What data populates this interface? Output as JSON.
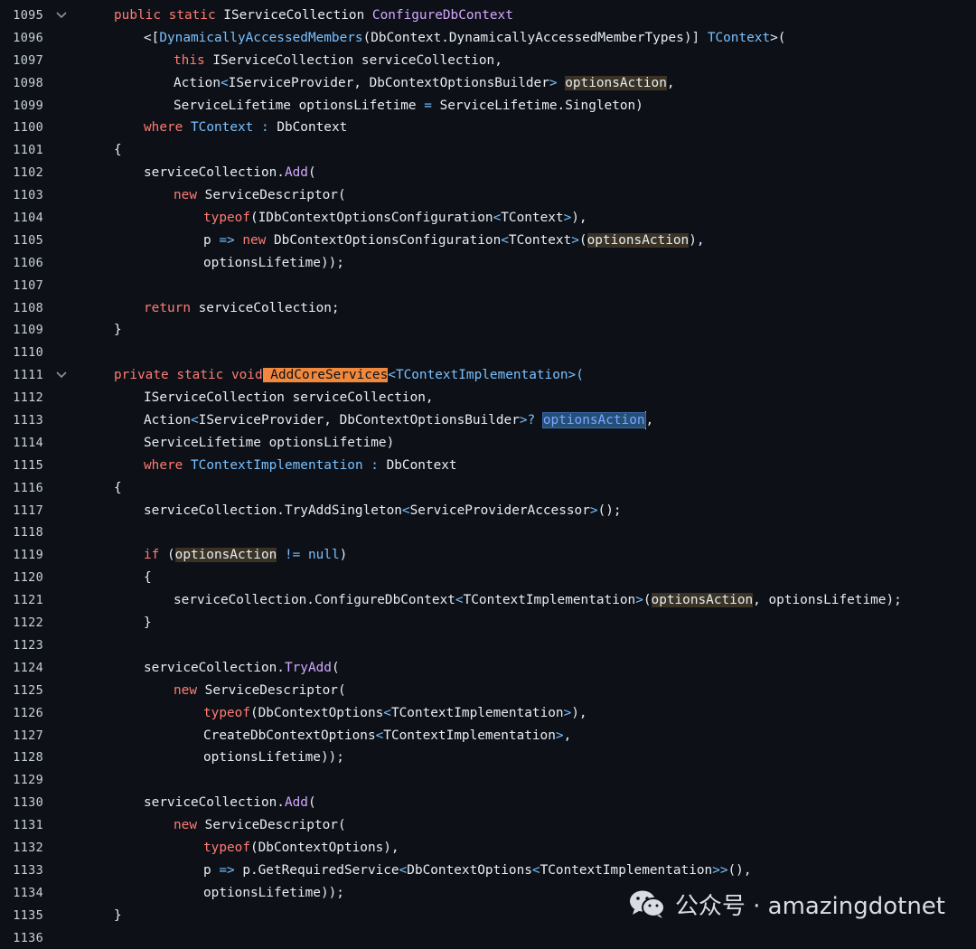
{
  "editor": {
    "lines": [
      {
        "num": "1095",
        "fold": "chevron-down-icon",
        "indent": 0,
        "tokens": [
          {
            "t": "public",
            "c": "kw"
          },
          {
            "t": " "
          },
          {
            "t": "static",
            "c": "kw"
          },
          {
            "t": " IServiceCollection ",
            "c": "id"
          },
          {
            "t": "ConfigureDbContext",
            "c": "fn"
          }
        ]
      },
      {
        "num": "1096",
        "indent": 1,
        "tokens": [
          {
            "t": "<[",
            "c": "p"
          },
          {
            "t": "DynamicallyAccessedMembers",
            "c": "ty"
          },
          {
            "t": "(DbContext.DynamicallyAccessedMemberTypes)] ",
            "c": "p"
          },
          {
            "t": "TContext",
            "c": "ty"
          },
          {
            "t": ">(",
            "c": "p"
          }
        ]
      },
      {
        "num": "1097",
        "indent": 2,
        "tokens": [
          {
            "t": "this",
            "c": "kw"
          },
          {
            "t": " IServiceCollection serviceCollection,",
            "c": "id"
          }
        ]
      },
      {
        "num": "1098",
        "indent": 2,
        "tokens": [
          {
            "t": "Action",
            "c": "id"
          },
          {
            "t": "<",
            "c": "op"
          },
          {
            "t": "IServiceProvider, DbContextOptionsBuilder",
            "c": "id"
          },
          {
            "t": ">",
            "c": "op"
          },
          {
            "t": " "
          },
          {
            "t": "optionsAction",
            "c": "id",
            "hl": "hl"
          },
          {
            "t": ",",
            "c": "p"
          }
        ]
      },
      {
        "num": "1099",
        "indent": 2,
        "tokens": [
          {
            "t": "ServiceLifetime optionsLifetime ",
            "c": "id"
          },
          {
            "t": "=",
            "c": "op"
          },
          {
            "t": " ServiceLifetime.Singleton)",
            "c": "id"
          }
        ]
      },
      {
        "num": "1100",
        "indent": 1,
        "tokens": [
          {
            "t": "where",
            "c": "kw"
          },
          {
            "t": " "
          },
          {
            "t": "TContext",
            "c": "ty"
          },
          {
            "t": " : ",
            "c": "op"
          },
          {
            "t": "DbContext",
            "c": "id"
          }
        ]
      },
      {
        "num": "1101",
        "indent": 0,
        "tokens": [
          {
            "t": "{",
            "c": "p"
          }
        ]
      },
      {
        "num": "1102",
        "indent": 1,
        "tokens": [
          {
            "t": "serviceCollection.",
            "c": "id"
          },
          {
            "t": "Add",
            "c": "fn"
          },
          {
            "t": "(",
            "c": "p"
          }
        ]
      },
      {
        "num": "1103",
        "indent": 2,
        "tokens": [
          {
            "t": "new",
            "c": "kw"
          },
          {
            "t": " ServiceDescriptor(",
            "c": "id"
          }
        ]
      },
      {
        "num": "1104",
        "indent": 3,
        "tokens": [
          {
            "t": "typeof",
            "c": "kw"
          },
          {
            "t": "(IDbContextOptionsConfiguration",
            "c": "id"
          },
          {
            "t": "<",
            "c": "op"
          },
          {
            "t": "TContext",
            "c": "id"
          },
          {
            "t": ">",
            "c": "op"
          },
          {
            "t": "),",
            "c": "p"
          }
        ]
      },
      {
        "num": "1105",
        "indent": 3,
        "tokens": [
          {
            "t": "p ",
            "c": "id"
          },
          {
            "t": "=>",
            "c": "op"
          },
          {
            "t": " "
          },
          {
            "t": "new",
            "c": "kw"
          },
          {
            "t": " DbContextOptionsConfiguration",
            "c": "id"
          },
          {
            "t": "<",
            "c": "op"
          },
          {
            "t": "TContext",
            "c": "id"
          },
          {
            "t": ">",
            "c": "op"
          },
          {
            "t": "(",
            "c": "p"
          },
          {
            "t": "optionsAction",
            "c": "id",
            "hl": "hl"
          },
          {
            "t": "),",
            "c": "p"
          }
        ]
      },
      {
        "num": "1106",
        "indent": 3,
        "tokens": [
          {
            "t": "optionsLifetime));",
            "c": "id"
          }
        ]
      },
      {
        "num": "1107",
        "indent": 0,
        "tokens": []
      },
      {
        "num": "1108",
        "indent": 1,
        "tokens": [
          {
            "t": "return",
            "c": "kw"
          },
          {
            "t": " serviceCollection;",
            "c": "id"
          }
        ]
      },
      {
        "num": "1109",
        "indent": 0,
        "tokens": [
          {
            "t": "}",
            "c": "p"
          }
        ]
      },
      {
        "num": "1110",
        "indent": 0,
        "tokens": []
      },
      {
        "num": "1111",
        "fold": "chevron-down-icon",
        "indent": 0,
        "tokens": [
          {
            "t": "private",
            "c": "kw"
          },
          {
            "t": " "
          },
          {
            "t": "static",
            "c": "kw"
          },
          {
            "t": " "
          },
          {
            "t": "void",
            "c": "kw"
          },
          {
            "t": " AddCoreServices",
            "c": "id",
            "hl": "hlo"
          },
          {
            "t": "<",
            "c": "op"
          },
          {
            "t": "TContextImplementation",
            "c": "ty"
          },
          {
            "t": ">(",
            "c": "op"
          }
        ]
      },
      {
        "num": "1112",
        "indent": 1,
        "tokens": [
          {
            "t": "IServiceCollection serviceCollection,",
            "c": "id"
          }
        ]
      },
      {
        "num": "1113",
        "indent": 1,
        "tokens": [
          {
            "t": "Action",
            "c": "id"
          },
          {
            "t": "<",
            "c": "op"
          },
          {
            "t": "IServiceProvider, DbContextOptionsBuilder",
            "c": "id"
          },
          {
            "t": ">?",
            "c": "op"
          },
          {
            "t": " "
          },
          {
            "t": "optionsAction",
            "c": "id",
            "hl": "sel"
          },
          {
            "t": "|",
            "c": "caret"
          },
          {
            "t": ",",
            "c": "p"
          }
        ]
      },
      {
        "num": "1114",
        "indent": 1,
        "tokens": [
          {
            "t": "ServiceLifetime optionsLifetime)",
            "c": "id"
          }
        ]
      },
      {
        "num": "1115",
        "indent": 1,
        "tokens": [
          {
            "t": "where",
            "c": "kw"
          },
          {
            "t": " "
          },
          {
            "t": "TContextImplementation",
            "c": "ty"
          },
          {
            "t": " : ",
            "c": "op"
          },
          {
            "t": "DbContext",
            "c": "id"
          }
        ]
      },
      {
        "num": "1116",
        "indent": 0,
        "tokens": [
          {
            "t": "{",
            "c": "p"
          }
        ]
      },
      {
        "num": "1117",
        "indent": 1,
        "tokens": [
          {
            "t": "serviceCollection.TryAddSingleton",
            "c": "id"
          },
          {
            "t": "<",
            "c": "op"
          },
          {
            "t": "ServiceProviderAccessor",
            "c": "id"
          },
          {
            "t": ">",
            "c": "op"
          },
          {
            "t": "();",
            "c": "p"
          }
        ]
      },
      {
        "num": "1118",
        "indent": 0,
        "tokens": []
      },
      {
        "num": "1119",
        "indent": 1,
        "tokens": [
          {
            "t": "if",
            "c": "kw"
          },
          {
            "t": " ("
          },
          {
            "t": "optionsAction",
            "c": "id",
            "hl": "hl"
          },
          {
            "t": " "
          },
          {
            "t": "!=",
            "c": "op"
          },
          {
            "t": " "
          },
          {
            "t": "null",
            "c": "ty"
          },
          {
            "t": ")",
            "c": "p"
          }
        ]
      },
      {
        "num": "1120",
        "indent": 1,
        "tokens": [
          {
            "t": "{",
            "c": "p"
          }
        ]
      },
      {
        "num": "1121",
        "indent": 2,
        "tokens": [
          {
            "t": "serviceCollection.ConfigureDbContext",
            "c": "id"
          },
          {
            "t": "<",
            "c": "op"
          },
          {
            "t": "TContextImplementation",
            "c": "id"
          },
          {
            "t": ">",
            "c": "op"
          },
          {
            "t": "(",
            "c": "p"
          },
          {
            "t": "optionsAction",
            "c": "id",
            "hl": "hl"
          },
          {
            "t": ", optionsLifetime);",
            "c": "id"
          }
        ]
      },
      {
        "num": "1122",
        "indent": 1,
        "tokens": [
          {
            "t": "}",
            "c": "p"
          }
        ]
      },
      {
        "num": "1123",
        "indent": 0,
        "tokens": []
      },
      {
        "num": "1124",
        "indent": 1,
        "tokens": [
          {
            "t": "serviceCollection.",
            "c": "id"
          },
          {
            "t": "TryAdd",
            "c": "fn"
          },
          {
            "t": "(",
            "c": "p"
          }
        ]
      },
      {
        "num": "1125",
        "indent": 2,
        "tokens": [
          {
            "t": "new",
            "c": "kw"
          },
          {
            "t": " ServiceDescriptor(",
            "c": "id"
          }
        ]
      },
      {
        "num": "1126",
        "indent": 3,
        "tokens": [
          {
            "t": "typeof",
            "c": "kw"
          },
          {
            "t": "(DbContextOptions",
            "c": "id"
          },
          {
            "t": "<",
            "c": "op"
          },
          {
            "t": "TContextImplementation",
            "c": "id"
          },
          {
            "t": ">",
            "c": "op"
          },
          {
            "t": "),",
            "c": "p"
          }
        ]
      },
      {
        "num": "1127",
        "indent": 3,
        "tokens": [
          {
            "t": "CreateDbContextOptions",
            "c": "id"
          },
          {
            "t": "<",
            "c": "op"
          },
          {
            "t": "TContextImplementation",
            "c": "id"
          },
          {
            "t": ">",
            "c": "op"
          },
          {
            "t": ",",
            "c": "p"
          }
        ]
      },
      {
        "num": "1128",
        "indent": 3,
        "tokens": [
          {
            "t": "optionsLifetime));",
            "c": "id"
          }
        ]
      },
      {
        "num": "1129",
        "indent": 0,
        "tokens": []
      },
      {
        "num": "1130",
        "indent": 1,
        "tokens": [
          {
            "t": "serviceCollection.",
            "c": "id"
          },
          {
            "t": "Add",
            "c": "fn"
          },
          {
            "t": "(",
            "c": "p"
          }
        ]
      },
      {
        "num": "1131",
        "indent": 2,
        "tokens": [
          {
            "t": "new",
            "c": "kw"
          },
          {
            "t": " ServiceDescriptor(",
            "c": "id"
          }
        ]
      },
      {
        "num": "1132",
        "indent": 3,
        "tokens": [
          {
            "t": "typeof",
            "c": "kw"
          },
          {
            "t": "(DbContextOptions),",
            "c": "id"
          }
        ]
      },
      {
        "num": "1133",
        "indent": 3,
        "tokens": [
          {
            "t": "p ",
            "c": "id"
          },
          {
            "t": "=>",
            "c": "op"
          },
          {
            "t": " p.GetRequiredService",
            "c": "id"
          },
          {
            "t": "<",
            "c": "op"
          },
          {
            "t": "DbContextOptions",
            "c": "id"
          },
          {
            "t": "<",
            "c": "op"
          },
          {
            "t": "TContextImplementation",
            "c": "id"
          },
          {
            "t": ">>",
            "c": "op"
          },
          {
            "t": "(),",
            "c": "p"
          }
        ]
      },
      {
        "num": "1134",
        "indent": 3,
        "tokens": [
          {
            "t": "optionsLifetime));",
            "c": "id"
          }
        ]
      },
      {
        "num": "1135",
        "indent": 0,
        "tokens": [
          {
            "t": "}",
            "c": "p"
          }
        ]
      },
      {
        "num": "1136",
        "indent": 0,
        "tokens": []
      }
    ]
  },
  "watermark": {
    "icon": "wechat-logo-icon",
    "text": "公众号 · amazingdotnet"
  },
  "colors": {
    "background": "#0d1117",
    "keyword": "#ff7b72",
    "type": "#79c0ff",
    "function": "#d2a8ff",
    "text": "#e6edf3",
    "highlight": "#3a3325",
    "search_highlight": "#f0883e",
    "selection": "#264f78"
  }
}
